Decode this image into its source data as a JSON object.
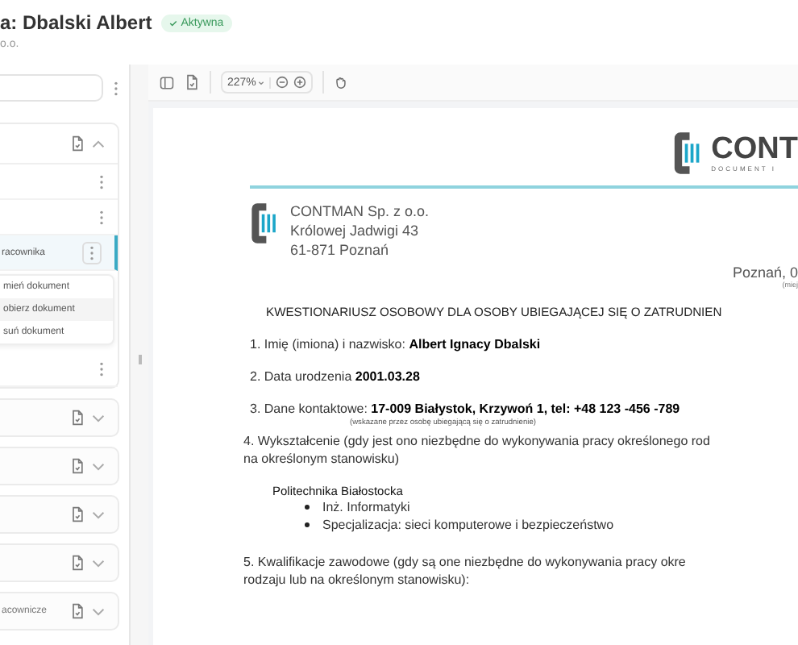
{
  "header": {
    "title": "a: Dbalski Albert",
    "status": "Aktywna",
    "subtitle": "o.o."
  },
  "sidebar": {
    "sections": [
      {
        "expanded": true,
        "rows": [
          {
            "selected": false
          },
          {
            "selected": false
          },
          {
            "label": "racownika",
            "selected": true
          },
          {
            "selected": false
          }
        ],
        "menu": [
          {
            "label": "mień dokument",
            "selected": false
          },
          {
            "label": "obierz dokument",
            "selected": true
          },
          {
            "label": "suń dokument",
            "selected": false
          }
        ]
      },
      {
        "expanded": false
      },
      {
        "expanded": false
      },
      {
        "expanded": false
      },
      {
        "expanded": false
      },
      {
        "expanded": false,
        "label": "acownicze"
      }
    ]
  },
  "viewer": {
    "zoom": "227%"
  },
  "document": {
    "logo": {
      "name": "CONT",
      "tagline": "DOCUMENT I"
    },
    "sender": [
      "CONTMAN Sp. z o.o.",
      "Królowej Jadwigi 43",
      "61-871 Poznań"
    ],
    "place_date": "Poznań, 0",
    "place_date_caption": "(miej",
    "heading": "KWESTIONARIUSZ OSOBOWY DLA OSOBY UBIEGAJĄCEJ SIĘ O ZATRUDNIEN",
    "items": [
      {
        "kind": "line",
        "text": "1. Imię (imiona) i nazwisko: **Albert Ignacy Dbalski**"
      },
      {
        "kind": "line",
        "text": "2. Data urodzenia **2001.03.28**"
      },
      {
        "kind": "line",
        "text": "3. Dane kontaktowe: **17-009 Białystok, Krzywoń 1, tel: +48 123 -456 -789**",
        "caption": "(wskazane przez osobę ubiegającą się o zatrudnienie)"
      },
      {
        "kind": "paragraph",
        "lines": [
          "4. Wykształcenie (gdy jest ono niezbędne do wykonywania pracy określonego rod",
          "na określonym stanowisku)"
        ]
      },
      {
        "kind": "school",
        "name": "Politechnika Białostocka",
        "bullets": [
          "Inż. Informatyki",
          "Specjalizacja: sieci komputerowe i bezpieczeństwo"
        ]
      },
      {
        "kind": "paragraph",
        "lines": [
          "5. Kwalifikacje zawodowe (gdy są one niezbędne do wykonywania pracy okre",
          "rodzaju lub na określonym stanowisku):"
        ]
      }
    ]
  }
}
